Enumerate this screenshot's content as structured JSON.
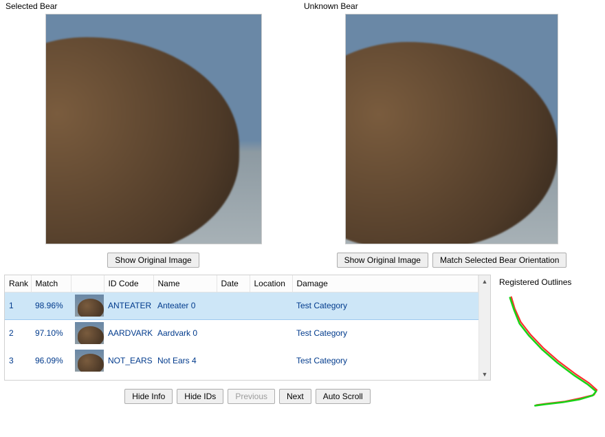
{
  "panels": {
    "left": {
      "title": "Selected Bear",
      "show_original": "Show Original Image"
    },
    "right": {
      "title": "Unknown Bear",
      "show_original": "Show Original Image",
      "match_orientation": "Match Selected Bear Orientation"
    }
  },
  "table": {
    "headers": {
      "rank": "Rank",
      "match": "Match",
      "thumb": "",
      "id": "ID Code",
      "name": "Name",
      "date": "Date",
      "location": "Location",
      "damage": "Damage"
    },
    "rows": [
      {
        "rank": "1",
        "match": "98.96%",
        "id": "ANTEATER",
        "name": "Anteater 0",
        "date": "",
        "location": "",
        "damage": "Test Category",
        "selected": true
      },
      {
        "rank": "2",
        "match": "97.10%",
        "id": "AARDVARK",
        "name": "Aardvark 0",
        "date": "",
        "location": "",
        "damage": "Test Category",
        "selected": false
      },
      {
        "rank": "3",
        "match": "96.09%",
        "id": "NOT_EARS",
        "name": "Not Ears 4",
        "date": "",
        "location": "",
        "damage": "Test Category",
        "selected": false
      }
    ]
  },
  "toolbar": {
    "hide_info": "Hide Info",
    "hide_ids": "Hide IDs",
    "previous": "Previous",
    "next": "Next",
    "auto_scroll": "Auto Scroll"
  },
  "outlines": {
    "title": "Registered Outlines"
  }
}
